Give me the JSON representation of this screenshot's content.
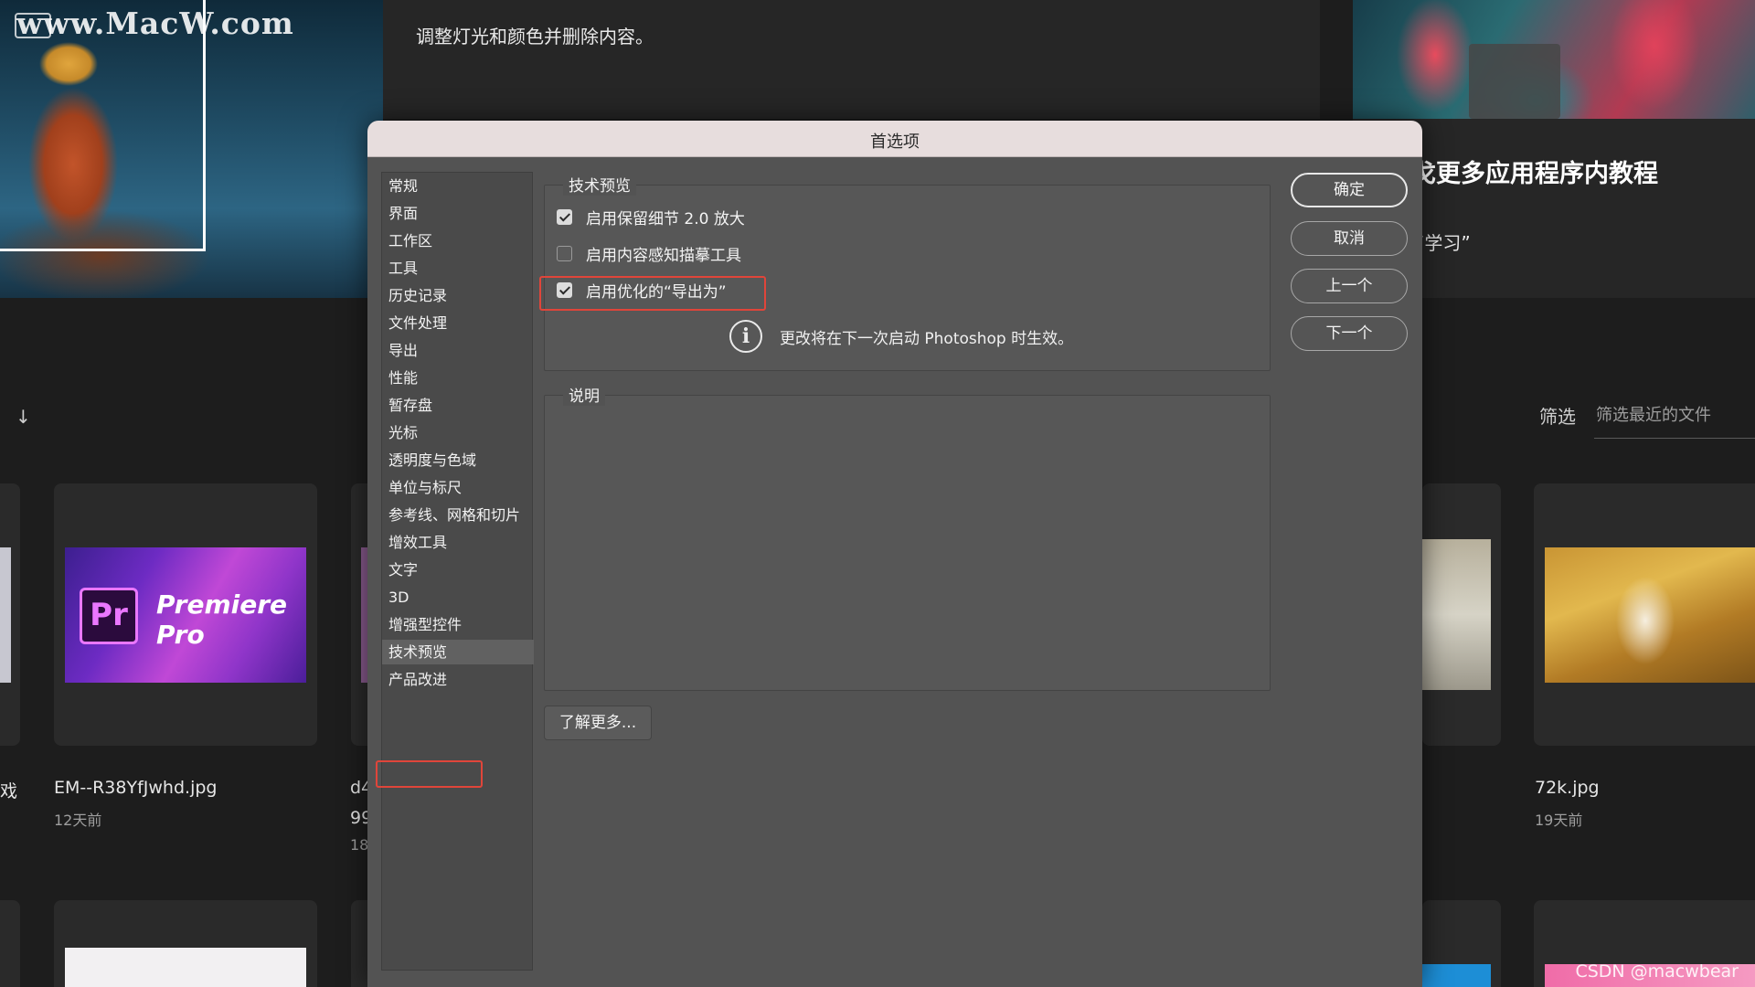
{
  "background": {
    "watermark": "www.MacW.com",
    "top_card_text": "调整灯光和颜色并删除内容。",
    "right_card_title": "戈更多应用程序内教程",
    "right_card_sub": "“学习”",
    "sort_icon": "↓",
    "filter_label": "筛选",
    "filter_placeholder": "筛选最近的文件",
    "premiere_logo": "Pr",
    "premiere_text": "Premiere Pro",
    "files": [
      {
        "name": "戏",
        "date": ""
      },
      {
        "name": "EM--R38YfJwhd.jpg",
        "date": "12天前"
      },
      {
        "name": "d4",
        "date": "99"
      },
      {
        "name": "72k.jpg",
        "date": "19天前"
      }
    ],
    "file_extra_date": "18",
    "csdn_mark": "CSDN @macwbear"
  },
  "dialog": {
    "title": "首选项",
    "sidebar": {
      "items": [
        {
          "label": "常规"
        },
        {
          "label": "界面"
        },
        {
          "label": "工作区"
        },
        {
          "label": "工具"
        },
        {
          "label": "历史记录"
        },
        {
          "label": "文件处理"
        },
        {
          "label": "导出"
        },
        {
          "label": "性能"
        },
        {
          "label": "暂存盘"
        },
        {
          "label": "光标"
        },
        {
          "label": "透明度与色域"
        },
        {
          "label": "单位与标尺"
        },
        {
          "label": "参考线、网格和切片"
        },
        {
          "label": "增效工具"
        },
        {
          "label": "文字"
        },
        {
          "label": "3D"
        },
        {
          "label": "增强型控件"
        },
        {
          "label": "技术预览"
        },
        {
          "label": "产品改进"
        }
      ],
      "selected_index": 17
    },
    "tech_preview": {
      "title": "技术预览",
      "options": [
        {
          "label": "启用保留细节 2.0 放大",
          "checked": true
        },
        {
          "label": "启用内容感知描摹工具",
          "checked": false
        },
        {
          "label": "启用优化的“导出为”",
          "checked": true
        }
      ],
      "info_icon": "i",
      "info_text": "更改将在下一次启动 Photoshop 时生效。"
    },
    "description": {
      "title": "说明"
    },
    "learn_more": "了解更多...",
    "buttons": {
      "ok": "确定",
      "cancel": "取消",
      "prev": "上一个",
      "next": "下一个"
    }
  }
}
